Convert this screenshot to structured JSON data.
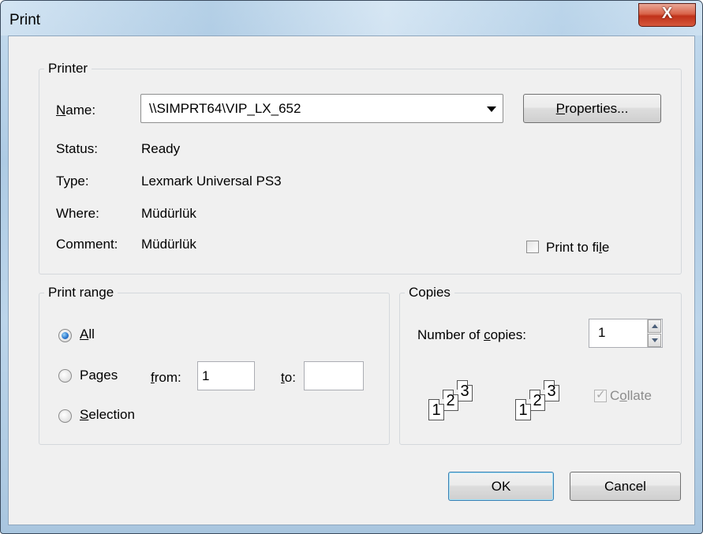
{
  "window": {
    "title": "Print",
    "close_glyph": "X"
  },
  "printer": {
    "group_label": "Printer",
    "name_label": "Name:",
    "name_value": "\\\\SIMPRT64\\VIP_LX_652",
    "properties_button": "Properties...",
    "status_label": "Status:",
    "status_value": "Ready",
    "type_label": "Type:",
    "type_value": "Lexmark Universal PS3",
    "where_label": "Where:",
    "where_value": "Müdürlük",
    "comment_label": "Comment:",
    "comment_value": "Müdürlük",
    "print_to_file_label": "Print to file",
    "print_to_file_checked": false
  },
  "print_range": {
    "group_label": "Print range",
    "all_label": "All",
    "pages_label": "Pages",
    "from_label": "from:",
    "from_value": "1",
    "to_label": "to:",
    "to_value": "",
    "selection_label": "Selection",
    "selected": "All"
  },
  "copies": {
    "group_label": "Copies",
    "number_label": "Number of copies:",
    "number_value": "1",
    "collate_label": "Collate",
    "collate_checked": true,
    "collate_enabled": false,
    "page_digits": [
      "1",
      "2",
      "3"
    ]
  },
  "buttons": {
    "ok": "OK",
    "cancel": "Cancel"
  }
}
